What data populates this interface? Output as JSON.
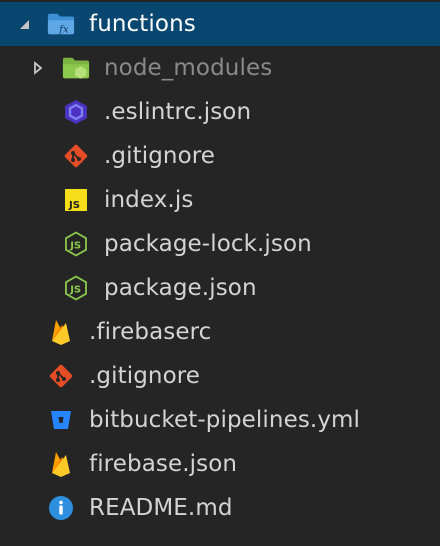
{
  "explorer": {
    "items": [
      {
        "name": "functions",
        "kind": "folder",
        "state": "expanded",
        "icon": "functions-folder-icon"
      },
      {
        "name": "node_modules",
        "kind": "folder",
        "state": "collapsed",
        "icon": "node-folder-icon"
      },
      {
        "name": ".eslintrc.json",
        "kind": "file",
        "icon": "eslint-icon"
      },
      {
        "name": ".gitignore",
        "kind": "file",
        "icon": "git-icon"
      },
      {
        "name": "index.js",
        "kind": "file",
        "icon": "javascript-icon"
      },
      {
        "name": "package-lock.json",
        "kind": "file",
        "icon": "nodejs-icon"
      },
      {
        "name": "package.json",
        "kind": "file",
        "icon": "nodejs-icon"
      },
      {
        "name": ".firebaserc",
        "kind": "file",
        "icon": "firebase-icon"
      },
      {
        "name": ".gitignore",
        "kind": "file",
        "icon": "git-icon"
      },
      {
        "name": "bitbucket-pipelines.yml",
        "kind": "file",
        "icon": "bitbucket-icon"
      },
      {
        "name": "firebase.json",
        "kind": "file",
        "icon": "firebase-icon"
      },
      {
        "name": "README.md",
        "kind": "file",
        "icon": "info-icon"
      }
    ],
    "colors": {
      "background": "#252526",
      "selection": "#094771",
      "text": "#d4d4d4",
      "dim_text": "#8a8a8a",
      "git": "#e44d26",
      "javascript": "#f5de19",
      "node": "#8cc84b",
      "eslint": "#4b32c3",
      "firebase": "#ffca28",
      "bitbucket": "#2684ff",
      "info": "#2e8fdf"
    }
  }
}
